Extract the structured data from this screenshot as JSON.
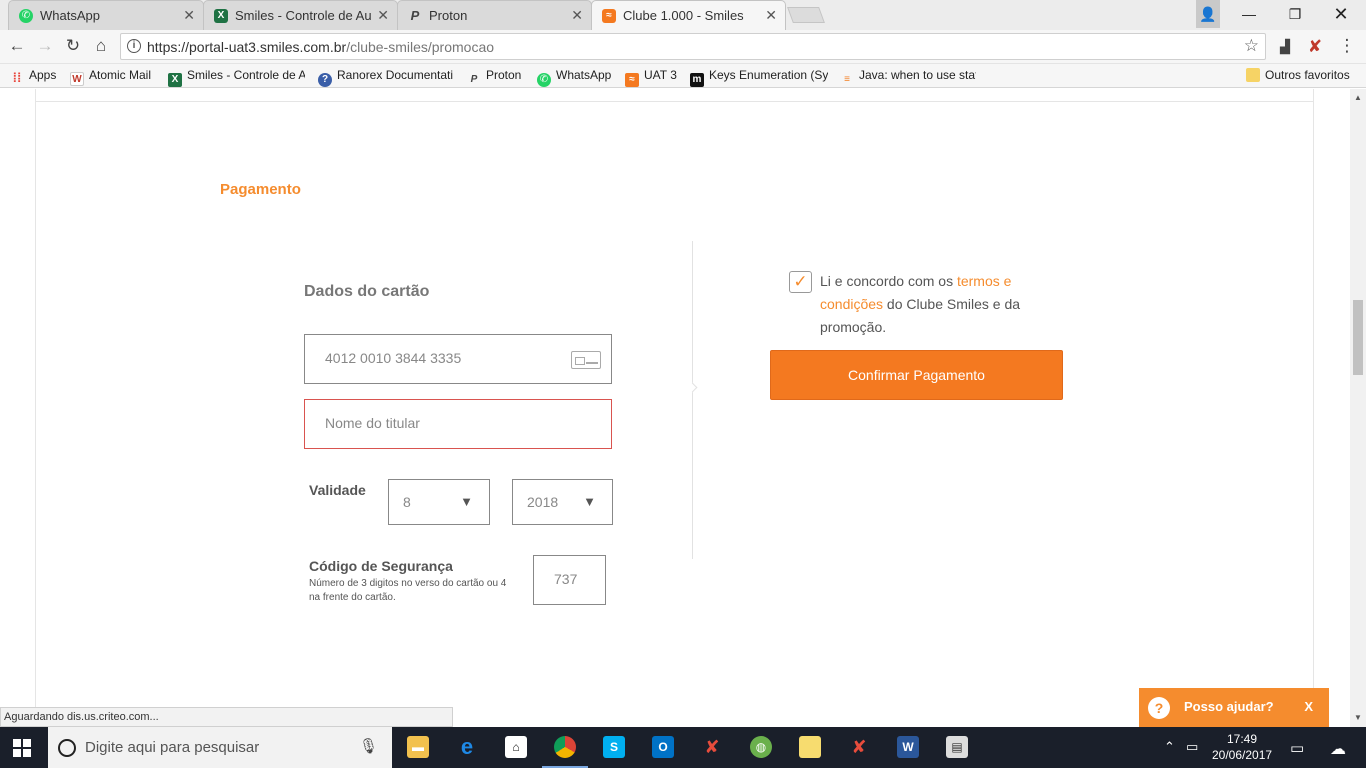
{
  "browser": {
    "tabs": [
      {
        "title": "WhatsApp",
        "icon": "whatsapp-icon",
        "color": "#25d366"
      },
      {
        "title": "Smiles - Controle de Aut",
        "icon": "excel-icon",
        "color": "#1f7244"
      },
      {
        "title": "Proton",
        "icon": "proton-icon",
        "color": "#555555"
      },
      {
        "title": "Clube 1.000 - Smiles",
        "icon": "smiles-icon",
        "color": "#f47920"
      }
    ],
    "url_host": "https://portal-uat3.smiles.com.br",
    "url_path": "/clube-smiles/promocao",
    "bookmarks": [
      {
        "label": "Apps",
        "icon": "apps-grid-icon"
      },
      {
        "label": "Atomic Mail",
        "icon": "atomic-mail-icon"
      },
      {
        "label": "Smiles - Controle de A",
        "icon": "excel-icon"
      },
      {
        "label": "Ranorex Documentati",
        "icon": "help-icon"
      },
      {
        "label": "Proton",
        "icon": "proton-icon"
      },
      {
        "label": "WhatsApp",
        "icon": "whatsapp-icon"
      },
      {
        "label": "UAT 3",
        "icon": "smiles-icon"
      },
      {
        "label": "Keys Enumeration (Sy",
        "icon": "m-icon"
      },
      {
        "label": "Java: when to use stat",
        "icon": "stackoverflow-icon"
      },
      {
        "label": "Outros favoritos",
        "icon": "folder-icon"
      }
    ]
  },
  "page": {
    "section_title": "Pagamento",
    "card_section_title": "Dados do cartão",
    "card_number": "4012 0010 3844 3335",
    "holder_placeholder": "Nome do titular",
    "validity_label": "Validade",
    "month": "8",
    "year": "2018",
    "security_label": "Código de Segurança",
    "security_help": "Número de 3 digitos no verso do cartão ou 4 na frente do cartão.",
    "cvv": "737",
    "terms_prefix": "Li e concordo com os ",
    "terms_link": "termos e condições",
    "terms_suffix": " do Clube Smiles e da promoção.",
    "confirm_label": "Confirmar Pagamento",
    "help_widget_label": "Posso ajudar?",
    "help_widget_close": "X",
    "status_text": "Aguardando dis.us.criteo.com...",
    "accent_color": "#f58c2e"
  },
  "taskbar": {
    "search_placeholder": "Digite aqui para pesquisar",
    "time": "17:49",
    "date": "20/06/2017"
  }
}
